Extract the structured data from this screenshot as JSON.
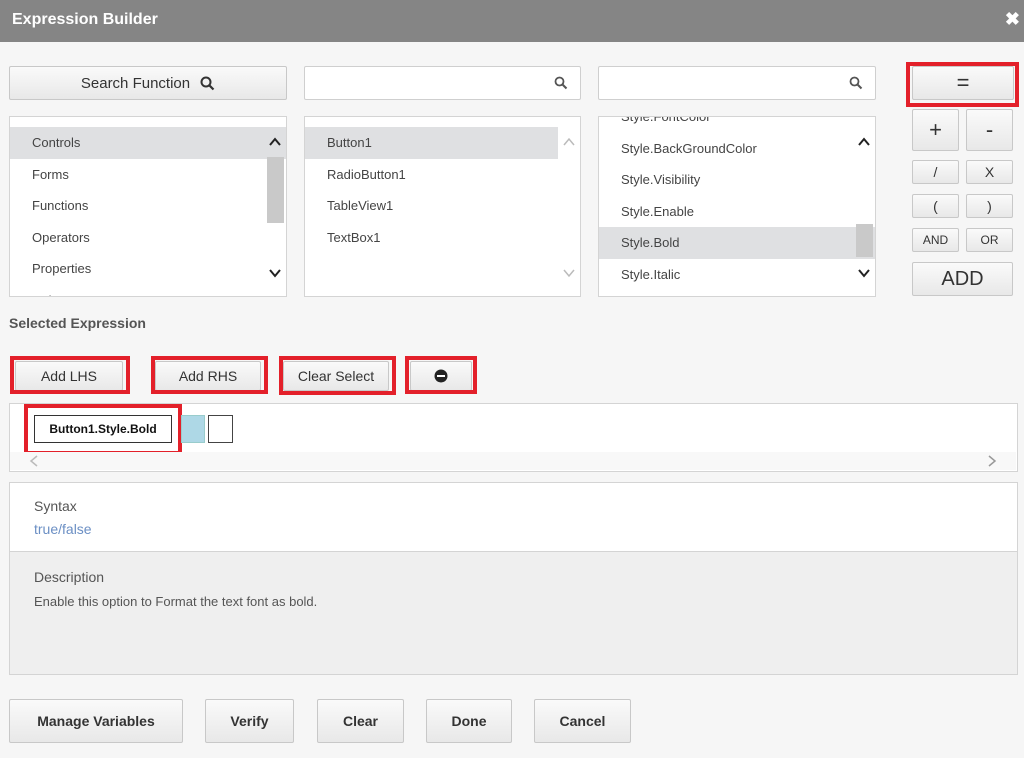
{
  "window": {
    "title": "Expression Builder",
    "close_glyph": "✖"
  },
  "search": {
    "function_button_label": "Search Function",
    "middle_placeholder": "",
    "right_placeholder": ""
  },
  "lists": {
    "categories": [
      "Controls",
      "Forms",
      "Functions",
      "Operators",
      "Properties",
      "Rules"
    ],
    "controls": [
      "Button1",
      "RadioButton1",
      "TableView1",
      "TextBox1"
    ],
    "properties": [
      "Style.FontColor",
      "Style.BackGroundColor",
      "Style.Visibility",
      "Style.Enable",
      "Style.Bold",
      "Style.Italic"
    ]
  },
  "operators": {
    "equals": "=",
    "plus": "+",
    "minus": "-",
    "divide": "/",
    "multiply": "X",
    "open_paren": "(",
    "close_paren": ")",
    "and": "AND",
    "or": "OR",
    "add": "ADD"
  },
  "selected_expression": {
    "label": "Selected Expression",
    "add_lhs": "Add LHS",
    "add_rhs": "Add RHS",
    "clear_select": "Clear Select",
    "chip": "Button1.Style.Bold"
  },
  "info": {
    "syntax_label": "Syntax",
    "syntax_value": "true/false",
    "description_label": "Description",
    "description_value": "Enable this option to Format the text font as bold."
  },
  "footer": {
    "manage_variables": "Manage Variables",
    "verify": "Verify",
    "clear": "Clear",
    "done": "Done",
    "cancel": "Cancel"
  },
  "colors": {
    "highlight": "#e3202a",
    "syntax": "#6b8fc4",
    "titlebar": "#858585"
  }
}
